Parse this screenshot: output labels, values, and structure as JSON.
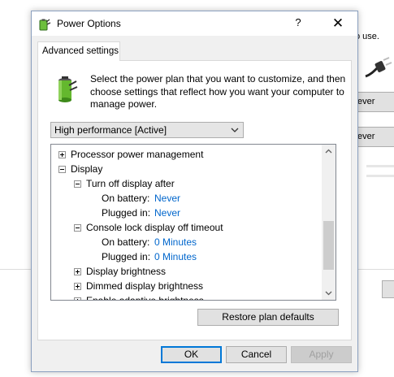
{
  "background": {
    "partial_text": "o use.",
    "button1_label": "ever",
    "button2_label": "ever"
  },
  "dialog": {
    "title": "Power Options",
    "help_label": "?",
    "close_label": "✕",
    "tab_label": "Advanced settings",
    "description": "Select the power plan that you want to customize, and then choose settings that reflect how you want your computer to manage power.",
    "plan_select_value": "High performance [Active]",
    "tree": [
      {
        "label": "Processor power management",
        "expander": "+"
      },
      {
        "label": "Display",
        "expander": "-"
      },
      {
        "label": "Turn off display after",
        "expander": "-"
      },
      {
        "label": "On battery:",
        "value": "Never"
      },
      {
        "label": "Plugged in:",
        "value": "Never"
      },
      {
        "label": "Console lock display off timeout",
        "expander": "-"
      },
      {
        "label": "On battery:",
        "value": "0 Minutes"
      },
      {
        "label": "Plugged in:",
        "value": "0 Minutes"
      },
      {
        "label": "Display brightness",
        "expander": "+"
      },
      {
        "label": "Dimmed display brightness",
        "expander": "+"
      },
      {
        "label": "Enable adaptive brightness",
        "expander": "+"
      }
    ],
    "restore_label": "Restore plan defaults",
    "ok_label": "OK",
    "cancel_label": "Cancel",
    "apply_label": "Apply"
  },
  "colors": {
    "value_link": "#0066cc",
    "ok_focus": "#0078d7"
  }
}
